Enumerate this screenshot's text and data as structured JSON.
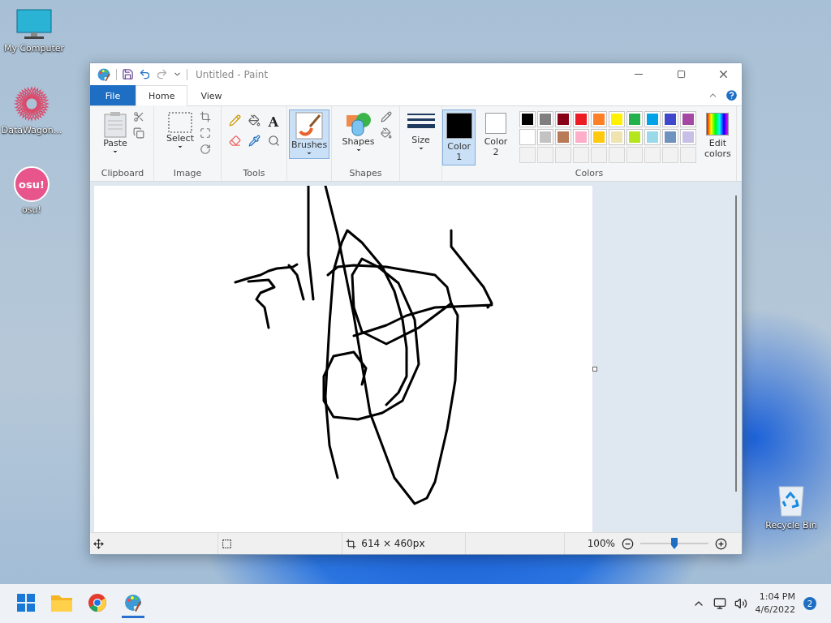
{
  "desktop_icons": [
    {
      "kind": "computer",
      "label": "My Computer"
    },
    {
      "kind": "datawagon",
      "label": "DataWagon..."
    },
    {
      "kind": "osu",
      "label": "osu!",
      "badge": "osu!"
    },
    {
      "kind": "recycle",
      "label": "Recycle Bin"
    }
  ],
  "window": {
    "title": "Untitled - Paint",
    "tabs": [
      {
        "kind": "file",
        "label": "File",
        "selected": false
      },
      {
        "kind": "tab",
        "label": "Home",
        "selected": true
      },
      {
        "kind": "tab",
        "label": "View",
        "selected": false
      }
    ],
    "ribbon": [
      {
        "kind": "clipboard",
        "label": "Clipboard",
        "buttons": [
          {
            "label": "Paste"
          }
        ]
      },
      {
        "kind": "image",
        "label": "Image",
        "buttons": [
          {
            "label": "Select"
          }
        ]
      },
      {
        "kind": "tools",
        "label": "Tools",
        "text_tool": "A"
      },
      {
        "kind": "brushes",
        "buttons": [
          {
            "label": "Brushes",
            "selected": true
          }
        ]
      },
      {
        "kind": "shapes",
        "label": "Shapes",
        "buttons": [
          {
            "label": "Shapes"
          }
        ]
      },
      {
        "kind": "size",
        "buttons": [
          {
            "label": "Size"
          }
        ]
      },
      {
        "kind": "colors",
        "label": "Colors",
        "slots": [
          {
            "label": "Color 1",
            "color": "#000000",
            "selected": true
          },
          {
            "label": "Color 2",
            "color": "#ffffff",
            "selected": false
          }
        ],
        "palette": [
          {
            "color": "#000000"
          },
          {
            "color": "#7f7f7f"
          },
          {
            "color": "#880015"
          },
          {
            "color": "#ed1c24"
          },
          {
            "color": "#ff7f27"
          },
          {
            "color": "#fff200"
          },
          {
            "color": "#22b14c"
          },
          {
            "color": "#00a2e8"
          },
          {
            "color": "#3f48cc"
          },
          {
            "color": "#a349a4"
          },
          {
            "color": "#ffffff"
          },
          {
            "color": "#c3c3c3"
          },
          {
            "color": "#b97a57"
          },
          {
            "color": "#ffaec9"
          },
          {
            "color": "#ffc90e"
          },
          {
            "color": "#efe4b0"
          },
          {
            "color": "#b5e61d"
          },
          {
            "color": "#99d9ea"
          },
          {
            "color": "#7092be"
          },
          {
            "color": "#c8bfe7"
          },
          {
            "kind": "empty"
          },
          {
            "kind": "empty"
          },
          {
            "kind": "empty"
          },
          {
            "kind": "empty"
          },
          {
            "kind": "empty"
          },
          {
            "kind": "empty"
          },
          {
            "kind": "empty"
          },
          {
            "kind": "empty"
          },
          {
            "kind": "empty"
          },
          {
            "kind": "empty"
          }
        ],
        "buttons": [
          {
            "label": "Edit colors"
          }
        ]
      }
    ],
    "status_bar": {
      "dimensions": "614 × 460px",
      "zoom": "100%",
      "zoom_slider": {
        "level": 0.5
      }
    }
  },
  "taskbar": {
    "apps": [
      {
        "kind": "start",
        "selected": false
      },
      {
        "kind": "explorer",
        "selected": false
      },
      {
        "kind": "chrome",
        "selected": false
      },
      {
        "kind": "paint",
        "selected": true
      }
    ],
    "time": "1:04 PM",
    "date": "4/6/2022",
    "notifications": "2"
  }
}
